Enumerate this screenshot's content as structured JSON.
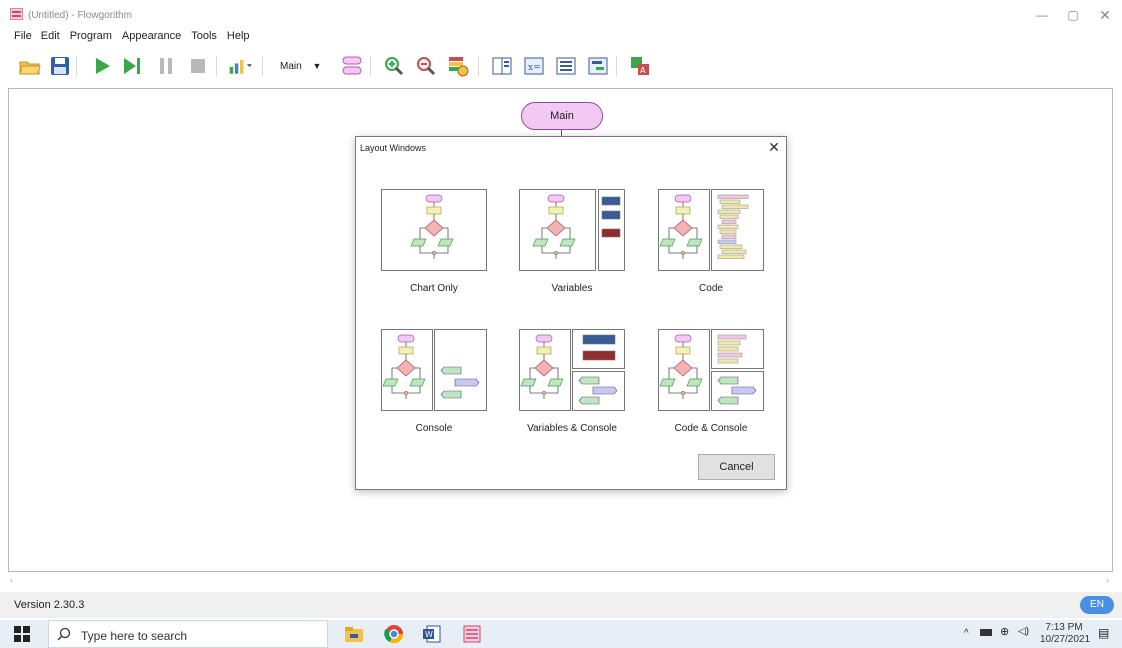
{
  "window": {
    "title": "(Untitled) - Flowgorithm",
    "min_glyph": "—",
    "max_glyph": "▢",
    "close_glyph": "✕"
  },
  "menu": [
    "File",
    "Edit",
    "Program",
    "Appearance",
    "Tools",
    "Help"
  ],
  "toolbar": {
    "function_select": "Main",
    "icons": [
      "open-folder-icon",
      "save-icon",
      "run-icon",
      "step-icon",
      "pause-icon",
      "stop-icon",
      "speed-icon",
      "function-manager-icon",
      "zoom-in-icon",
      "zoom-out-icon",
      "generate-icon",
      "layout-windows-icon",
      "variables-icon",
      "code-view-icon",
      "console-icon",
      "translate-icon"
    ]
  },
  "canvas": {
    "main_node": "Main"
  },
  "dialog": {
    "title": "Layout Windows",
    "options": [
      {
        "label": "Chart Only",
        "kind": "chart"
      },
      {
        "label": "Variables",
        "kind": "variables"
      },
      {
        "label": "Code",
        "kind": "code"
      },
      {
        "label": "Console",
        "kind": "console"
      },
      {
        "label": "Variables & Console",
        "kind": "variables-console"
      },
      {
        "label": "Code & Console",
        "kind": "code-console"
      }
    ],
    "cancel_label": "Cancel"
  },
  "status": {
    "version": "Version 2.30.3",
    "language": "EN"
  },
  "taskbar": {
    "search_placeholder": "Type here to search",
    "time": "7:13 PM",
    "date": "10/27/2021"
  },
  "colors": {
    "flow_start": "#f3c9f3",
    "flow_process": "#f5f0b8",
    "flow_decision": "#f3b3b3",
    "flow_io": "#bfe6bf",
    "var_blue": "#3a5b9a",
    "var_red": "#8e2e2e",
    "code_pink": "#f5c4dd",
    "code_yellow": "#f3e9a6",
    "console_blue": "#c7c9f2"
  }
}
